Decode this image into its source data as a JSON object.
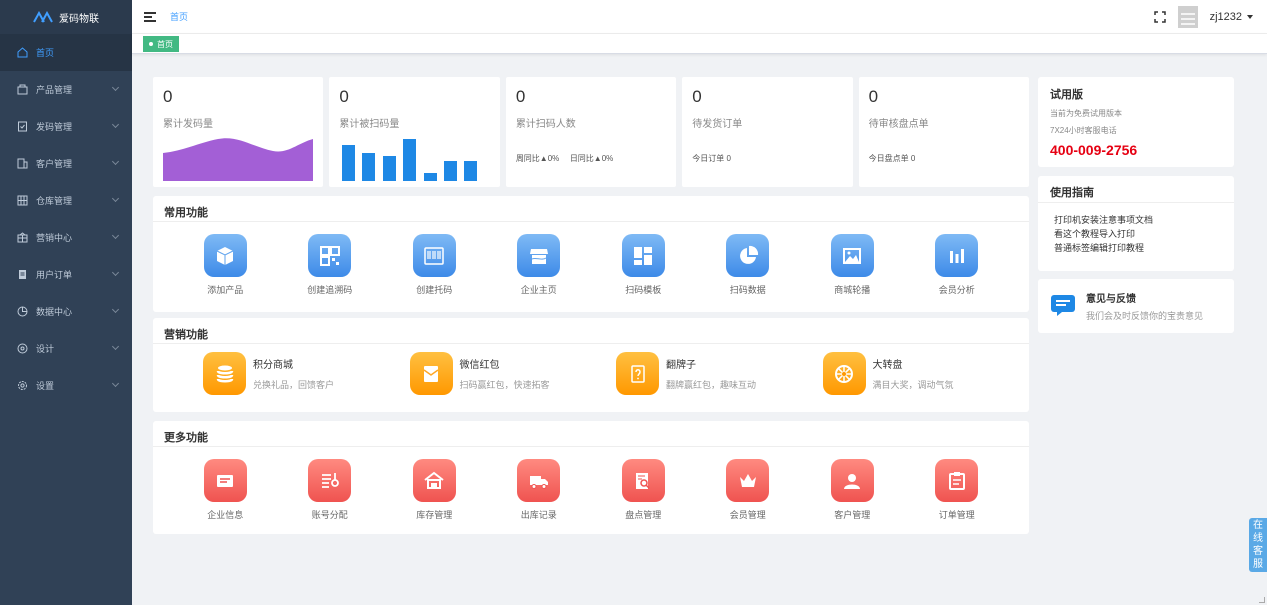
{
  "brand": {
    "name": "爱码物联"
  },
  "sidebar": {
    "items": [
      {
        "label": "首页",
        "icon": "home-icon"
      },
      {
        "label": "产品管理",
        "icon": "box-icon"
      },
      {
        "label": "发码管理",
        "icon": "code-icon"
      },
      {
        "label": "客户管理",
        "icon": "customer-icon"
      },
      {
        "label": "仓库管理",
        "icon": "warehouse-icon"
      },
      {
        "label": "营销中心",
        "icon": "marketing-icon"
      },
      {
        "label": "用户订单",
        "icon": "order-icon"
      },
      {
        "label": "数据中心",
        "icon": "chart-icon"
      },
      {
        "label": "设计",
        "icon": "design-icon"
      },
      {
        "label": "设置",
        "icon": "settings-icon"
      }
    ]
  },
  "header": {
    "breadcrumb": "首页",
    "username": "zj1232"
  },
  "tags": {
    "active": "首页"
  },
  "stats": [
    {
      "value": "0",
      "label": "累计发码量"
    },
    {
      "value": "0",
      "label": "累计被扫码量"
    },
    {
      "value": "0",
      "label": "累计扫码人数",
      "sub1": "周同比▲0%",
      "sub2": "日同比▲0%"
    },
    {
      "value": "0",
      "label": "待发货订单",
      "sub1": "今日订单  0"
    },
    {
      "value": "0",
      "label": "待审核盘点单",
      "sub1": "今日盘点单  0"
    }
  ],
  "common": {
    "title": "常用功能",
    "items": [
      "添加产品",
      "创建追溯码",
      "创建托码",
      "企业主页",
      "扫码模板",
      "扫码数据",
      "商城轮播",
      "会员分析"
    ]
  },
  "marketing": {
    "title": "营销功能",
    "items": [
      {
        "title": "积分商城",
        "desc": "兑换礼品，回馈客户"
      },
      {
        "title": "微信红包",
        "desc": "扫码赢红包，快速拓客"
      },
      {
        "title": "翻牌子",
        "desc": "翻牌赢红包，趣味互动"
      },
      {
        "title": "大转盘",
        "desc": "满目大奖，调动气氛"
      }
    ]
  },
  "more": {
    "title": "更多功能",
    "items": [
      "企业信息",
      "账号分配",
      "库存管理",
      "出库记录",
      "盘点管理",
      "会员管理",
      "客户管理",
      "订单管理"
    ]
  },
  "trial": {
    "title": "试用版",
    "line1": "当前为免费试用版本",
    "line2": "7X24小时客服电话",
    "phone": "400-009-2756"
  },
  "guide": {
    "title": "使用指南",
    "links": [
      "打印机安装注意事项文档",
      "看这个教程导入打印",
      "普通标签编辑打印教程"
    ]
  },
  "feedback": {
    "title": "意见与反馈",
    "desc": "我们会及时反馈你的宝贵意见"
  },
  "online_service": [
    "在",
    "线",
    "客",
    "服"
  ],
  "colors": {
    "sidebar": "#304156",
    "accent": "#409eff",
    "tag": "#42b983",
    "phone": "#e60012"
  }
}
